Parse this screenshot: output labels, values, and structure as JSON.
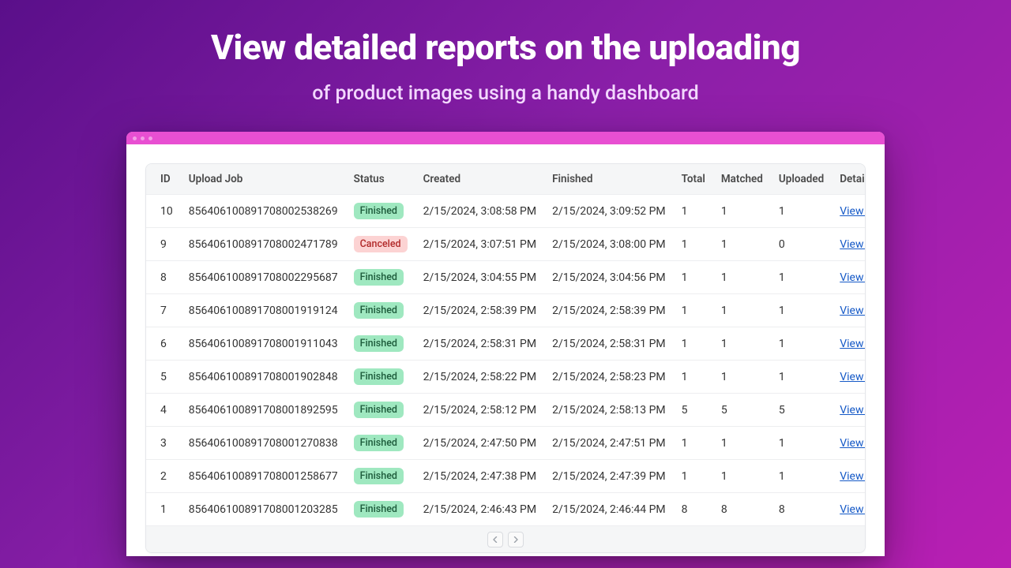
{
  "hero": {
    "title": "View detailed reports on the uploading",
    "subtitle": "of product images using a handy dashboard"
  },
  "table": {
    "headers": {
      "id": "ID",
      "upload_job": "Upload Job",
      "status": "Status",
      "created": "Created",
      "finished": "Finished",
      "total": "Total",
      "matched": "Matched",
      "uploaded": "Uploaded",
      "details": "Details"
    },
    "view_log_label": "View Log",
    "status_labels": {
      "finished": "Finished",
      "canceled": "Canceled"
    },
    "status_colors": {
      "finished": "#9fe8c0",
      "canceled": "#fcd3d3"
    },
    "link_color": "#1559c7",
    "rows": [
      {
        "id": "10",
        "job": "856406100891708002538269",
        "status": "finished",
        "created": "2/15/2024, 3:08:58 PM",
        "finished": "2/15/2024, 3:09:52 PM",
        "total": "1",
        "matched": "1",
        "uploaded": "1"
      },
      {
        "id": "9",
        "job": "856406100891708002471789",
        "status": "canceled",
        "created": "2/15/2024, 3:07:51 PM",
        "finished": "2/15/2024, 3:08:00 PM",
        "total": "1",
        "matched": "1",
        "uploaded": "0"
      },
      {
        "id": "8",
        "job": "856406100891708002295687",
        "status": "finished",
        "created": "2/15/2024, 3:04:55 PM",
        "finished": "2/15/2024, 3:04:56 PM",
        "total": "1",
        "matched": "1",
        "uploaded": "1"
      },
      {
        "id": "7",
        "job": "856406100891708001919124",
        "status": "finished",
        "created": "2/15/2024, 2:58:39 PM",
        "finished": "2/15/2024, 2:58:39 PM",
        "total": "1",
        "matched": "1",
        "uploaded": "1"
      },
      {
        "id": "6",
        "job": "856406100891708001911043",
        "status": "finished",
        "created": "2/15/2024, 2:58:31 PM",
        "finished": "2/15/2024, 2:58:31 PM",
        "total": "1",
        "matched": "1",
        "uploaded": "1"
      },
      {
        "id": "5",
        "job": "856406100891708001902848",
        "status": "finished",
        "created": "2/15/2024, 2:58:22 PM",
        "finished": "2/15/2024, 2:58:23 PM",
        "total": "1",
        "matched": "1",
        "uploaded": "1"
      },
      {
        "id": "4",
        "job": "856406100891708001892595",
        "status": "finished",
        "created": "2/15/2024, 2:58:12 PM",
        "finished": "2/15/2024, 2:58:13 PM",
        "total": "5",
        "matched": "5",
        "uploaded": "5"
      },
      {
        "id": "3",
        "job": "856406100891708001270838",
        "status": "finished",
        "created": "2/15/2024, 2:47:50 PM",
        "finished": "2/15/2024, 2:47:51 PM",
        "total": "1",
        "matched": "1",
        "uploaded": "1"
      },
      {
        "id": "2",
        "job": "856406100891708001258677",
        "status": "finished",
        "created": "2/15/2024, 2:47:38 PM",
        "finished": "2/15/2024, 2:47:39 PM",
        "total": "1",
        "matched": "1",
        "uploaded": "1"
      },
      {
        "id": "1",
        "job": "856406100891708001203285",
        "status": "finished",
        "created": "2/15/2024, 2:46:43 PM",
        "finished": "2/15/2024, 2:46:44 PM",
        "total": "8",
        "matched": "8",
        "uploaded": "8"
      }
    ]
  }
}
